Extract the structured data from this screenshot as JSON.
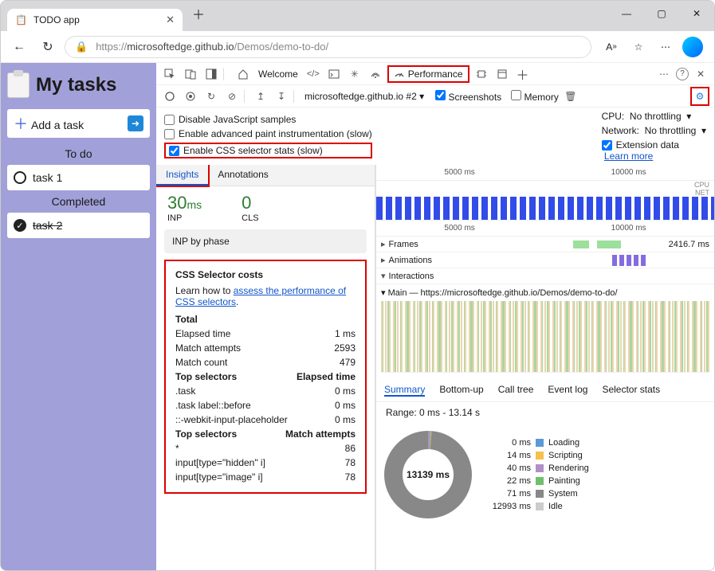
{
  "tab": {
    "title": "TODO app"
  },
  "url": {
    "scheme": "https://",
    "host": "microsoftedge.github.io",
    "path": "/Demos/demo-to-do/"
  },
  "page": {
    "title": "My tasks",
    "add_placeholder": "Add a task",
    "todo_label": "To do",
    "completed_label": "Completed",
    "task1": "task 1",
    "task2": "task 2"
  },
  "devtools": {
    "tabs": {
      "welcome": "Welcome",
      "performance": "Performance"
    },
    "recording_name": "microsoftedge.github.io #2",
    "screenshots_label": "Screenshots",
    "memory_label": "Memory",
    "settings": {
      "disable_js": "Disable JavaScript samples",
      "paint_instr": "Enable advanced paint instrumentation (slow)",
      "css_stats": "Enable CSS selector stats (slow)",
      "cpu_label": "CPU:",
      "cpu_value": "No throttling",
      "network_label": "Network:",
      "network_value": "No throttling",
      "extension_label": "Extension data",
      "learn_more": "Learn more"
    },
    "inner_tabs": {
      "insights": "Insights",
      "annotations": "Annotations"
    },
    "metrics": {
      "inp_val": "30",
      "inp_unit": "ms",
      "inp_lbl": "INP",
      "cls_val": "0",
      "cls_lbl": "CLS"
    },
    "phase_title": "INP by phase",
    "css_panel": {
      "title": "CSS Selector costs",
      "hint_prefix": "Learn how to ",
      "hint_link": "assess the performance of CSS selectors",
      "hint_suffix": ".",
      "total_label": "Total",
      "rows": [
        {
          "k": "Elapsed time",
          "v": "1 ms"
        },
        {
          "k": "Match attempts",
          "v": "2593"
        },
        {
          "k": "Match count",
          "v": "479"
        }
      ],
      "top_selectors_1": {
        "header_l": "Top selectors",
        "header_r": "Elapsed time",
        "rows": [
          {
            "k": ".task",
            "v": "0 ms"
          },
          {
            "k": ".task label::before",
            "v": "0 ms"
          },
          {
            "k": "::-webkit-input-placeholder",
            "v": "0 ms"
          }
        ]
      },
      "top_selectors_2": {
        "header_l": "Top selectors",
        "header_r": "Match attempts",
        "rows": [
          {
            "k": "*",
            "v": "86"
          },
          {
            "k": "input[type=\"hidden\" i]",
            "v": "78"
          },
          {
            "k": "input[type=\"image\" i]",
            "v": "78"
          }
        ]
      }
    },
    "timeline": {
      "t1": "5000 ms",
      "t2": "10000 ms"
    },
    "tracks": {
      "cpu": "CPU",
      "net": "NET",
      "frames": "Frames",
      "frames_val": "2416.7 ms",
      "animations": "Animations",
      "interactions": "Interactions",
      "main": "Main — https://microsoftedge.github.io/Demos/demo-to-do/"
    },
    "subtabs": [
      "Summary",
      "Bottom-up",
      "Call tree",
      "Event log",
      "Selector stats"
    ],
    "summary": {
      "range": "Range: 0 ms - 13.14 s",
      "total": "13139 ms",
      "legend": [
        {
          "ms": "0 ms",
          "label": "Loading",
          "color": "#5b9bd5"
        },
        {
          "ms": "14 ms",
          "label": "Scripting",
          "color": "#f2c14e"
        },
        {
          "ms": "40 ms",
          "label": "Rendering",
          "color": "#b08fc7"
        },
        {
          "ms": "22 ms",
          "label": "Painting",
          "color": "#6fbf6f"
        },
        {
          "ms": "71 ms",
          "label": "System",
          "color": "#888"
        },
        {
          "ms": "12993 ms",
          "label": "Idle",
          "color": "#ccc"
        }
      ]
    }
  }
}
